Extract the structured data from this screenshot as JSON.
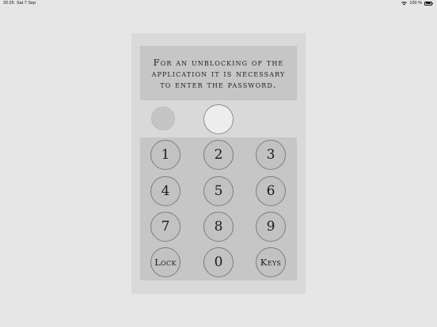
{
  "status_bar": {
    "time": "20:25",
    "date": "Sat 7 Sep",
    "battery": "100 %",
    "battery_level": 1.0
  },
  "message": {
    "text": "For an unblocking of the application it is necessary to enter the password."
  },
  "keypad": {
    "keys": [
      "1",
      "2",
      "3",
      "4",
      "5",
      "6",
      "7",
      "8",
      "9",
      "Lock",
      "0",
      "Keys"
    ]
  }
}
